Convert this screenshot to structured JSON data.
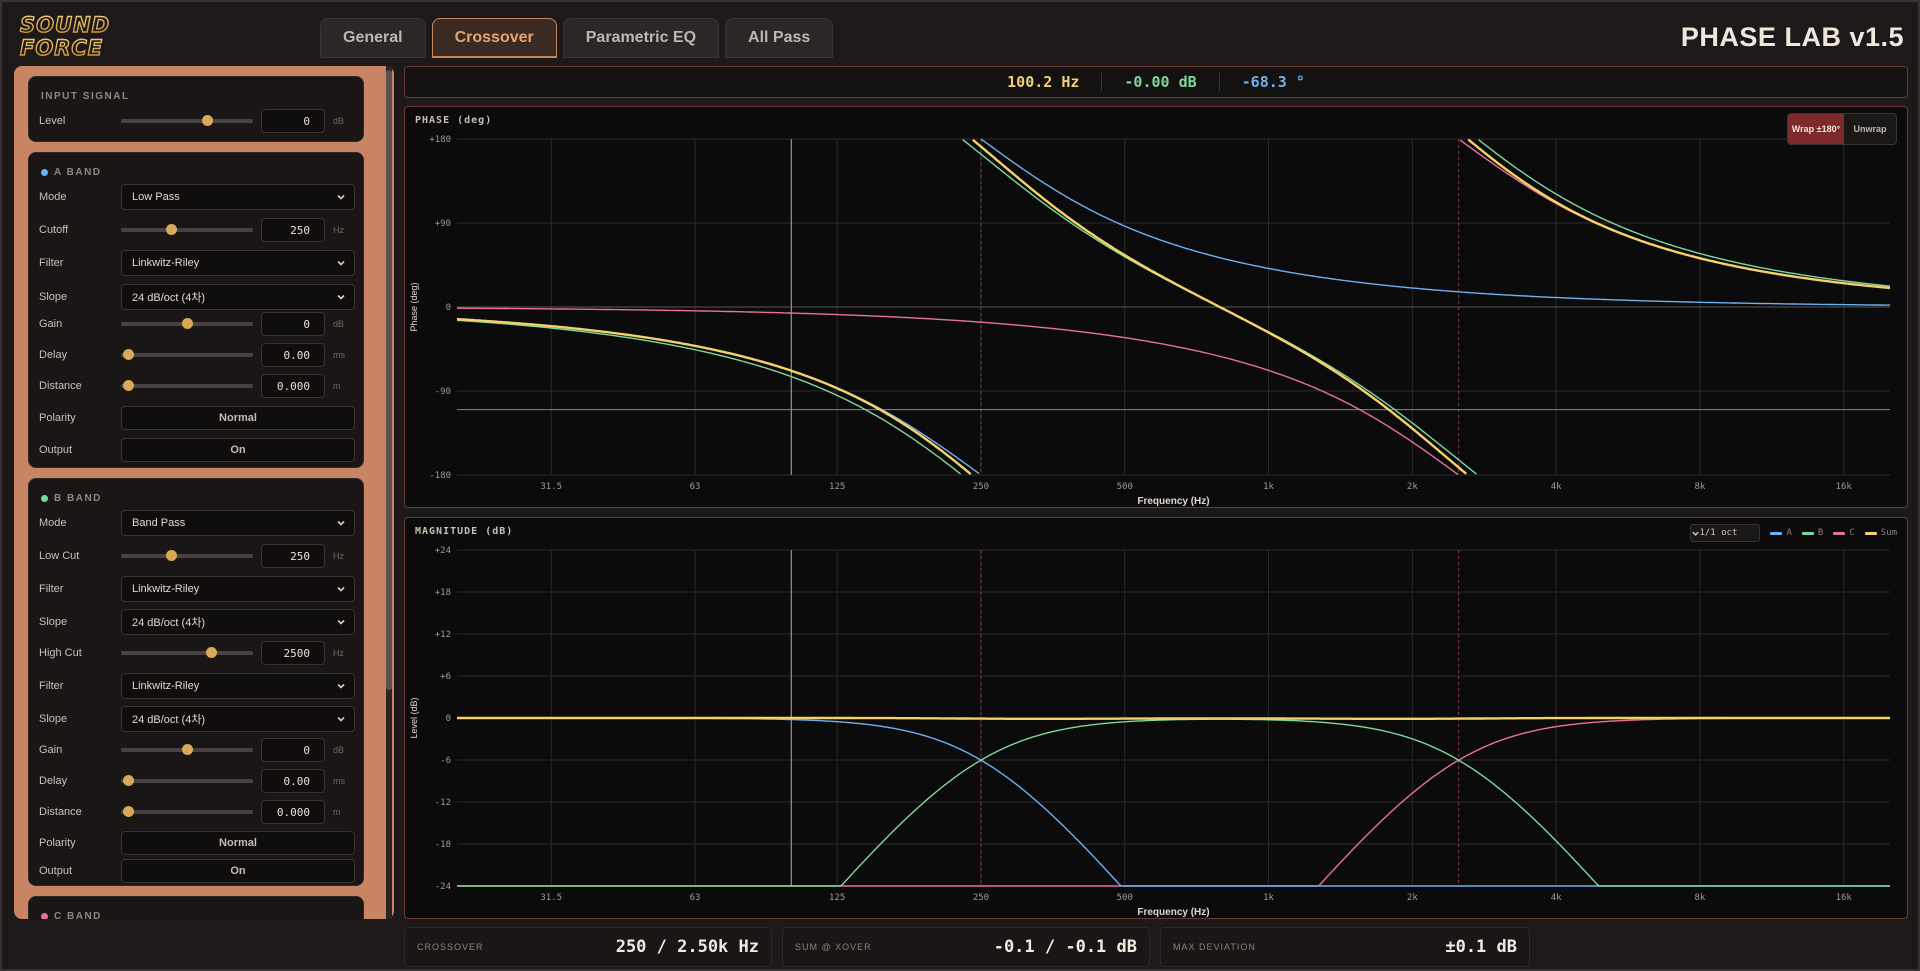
{
  "header": {
    "logo_lines": [
      "SOUND",
      "FORCE"
    ],
    "tabs": [
      "General",
      "Crossover",
      "Parametric EQ",
      "All Pass"
    ],
    "active_tab": 1,
    "title": "PHASE LAB v1.5"
  },
  "readout": {
    "frequency": "100.2 Hz",
    "level": "-0.00 dB",
    "phase": "-68.3 °"
  },
  "sidebar": {
    "input": {
      "title": "INPUT SIGNAL",
      "level_label": "Level",
      "level_value": "0",
      "level_unit": "dB",
      "level_pos": 0.65
    },
    "a_band": {
      "title": "A BAND",
      "color": "#6fb0ee",
      "mode_label": "Mode",
      "mode": "Low Pass",
      "cutoff_label": "Cutoff",
      "cutoff": "250",
      "cutoff_unit": "Hz",
      "cutoff_pos": 0.38,
      "filter_label": "Filter",
      "filter": "Linkwitz-Riley",
      "slope_label": "Slope",
      "slope": "24 dB/oct (4차)",
      "gain_label": "Gain",
      "gain": "0",
      "gain_unit": "dB",
      "gain_pos": 0.5,
      "delay_label": "Delay",
      "delay": "0.00",
      "delay_unit": "ms",
      "delay_pos": 0.05,
      "distance_label": "Distance",
      "distance": "0.000",
      "distance_unit": "m",
      "distance_pos": 0.05,
      "polarity_label": "Polarity",
      "polarity": "Normal",
      "output_label": "Output",
      "output": "On"
    },
    "b_band": {
      "title": "B BAND",
      "color": "#7fd89a",
      "mode_label": "Mode",
      "mode": "Band Pass",
      "lowcut_label": "Low Cut",
      "lowcut": "250",
      "lowcut_unit": "Hz",
      "lowcut_pos": 0.38,
      "filter1_label": "Filter",
      "filter1": "Linkwitz-Riley",
      "slope1_label": "Slope",
      "slope1": "24 dB/oct (4차)",
      "highcut_label": "High Cut",
      "highcut": "2500",
      "highcut_unit": "Hz",
      "highcut_pos": 0.68,
      "filter2_label": "Filter",
      "filter2": "Linkwitz-Riley",
      "slope2_label": "Slope",
      "slope2": "24 dB/oct (4차)",
      "gain_label": "Gain",
      "gain": "0",
      "gain_unit": "dB",
      "gain_pos": 0.5,
      "delay_label": "Delay",
      "delay": "0.00",
      "delay_unit": "ms",
      "delay_pos": 0.05,
      "distance_label": "Distance",
      "distance": "0.000",
      "distance_unit": "m",
      "distance_pos": 0.05,
      "polarity_label": "Polarity",
      "polarity": "Normal",
      "output_label": "Output",
      "output": "On"
    },
    "c_band": {
      "title": "C BAND",
      "color": "#e8719a"
    }
  },
  "phase_chart": {
    "title": "PHASE (deg)",
    "wrap_label": "Wrap ±180°",
    "unwrap_label": "Unwrap",
    "wrap_active": true
  },
  "magnitude_chart": {
    "title": "MAGNITUDE (dB)",
    "resolution": "1/1 oct",
    "legend": [
      "A",
      "B",
      "C",
      "Sum"
    ]
  },
  "colors": {
    "a": "#6fb0ee",
    "b": "#7fd89a",
    "c": "#e8719a",
    "sum": "#f5d16a",
    "accent": "#c98463"
  },
  "chart_data": [
    {
      "type": "line",
      "title": "PHASE (deg)",
      "xlabel": "Frequency (Hz)",
      "ylabel": "Phase (deg)",
      "x_scale": "log",
      "xlim": [
        20,
        20000
      ],
      "ylim": [
        -180,
        180
      ],
      "x_ticks": [
        "31.5",
        "63",
        "125",
        "250",
        "500",
        "1k",
        "2k",
        "4k",
        "8k",
        "16k"
      ],
      "y_ticks": [
        "+180",
        "+90",
        "0",
        "-90",
        "-180"
      ],
      "cursor_hz": 100.2,
      "cursor_phase": -68.3,
      "crossover_markers_hz": [
        250,
        2500
      ],
      "wrap": true,
      "series": [
        {
          "name": "A",
          "filter": "LR4 low-pass 250 Hz"
        },
        {
          "name": "B",
          "filter": "LR4 band-pass 250 Hz – 2500 Hz"
        },
        {
          "name": "C",
          "filter": "LR4 high-pass 2500 Hz"
        },
        {
          "name": "Sum",
          "filter": "A + B + C"
        }
      ]
    },
    {
      "type": "line",
      "title": "MAGNITUDE (dB)",
      "xlabel": "Frequency (Hz)",
      "ylabel": "Level (dB)",
      "x_scale": "log",
      "xlim": [
        20,
        20000
      ],
      "ylim": [
        -24,
        24
      ],
      "x_ticks": [
        "31.5",
        "63",
        "125",
        "250",
        "500",
        "1k",
        "2k",
        "4k",
        "8k",
        "16k"
      ],
      "y_ticks": [
        "+24",
        "+18",
        "+12",
        "+6",
        "0",
        "-6",
        "-12",
        "-18",
        "-24"
      ],
      "cursor_hz": 100.2,
      "crossover_markers_hz": [
        250,
        2500
      ],
      "series": [
        {
          "name": "A",
          "filter": "LR4 low-pass 250 Hz"
        },
        {
          "name": "B",
          "filter": "LR4 band-pass 250 Hz – 2500 Hz"
        },
        {
          "name": "C",
          "filter": "LR4 high-pass 2500 Hz"
        },
        {
          "name": "Sum",
          "filter": "A + B + C"
        }
      ]
    }
  ],
  "stats": {
    "crossover_label": "CROSSOVER",
    "crossover": "250 / 2.50k Hz",
    "sum_label": "SUM @ XOVER",
    "sum": "-0.1 / -0.1 dB",
    "dev_label": "MAX DEVIATION",
    "dev": "±0.1 dB"
  }
}
